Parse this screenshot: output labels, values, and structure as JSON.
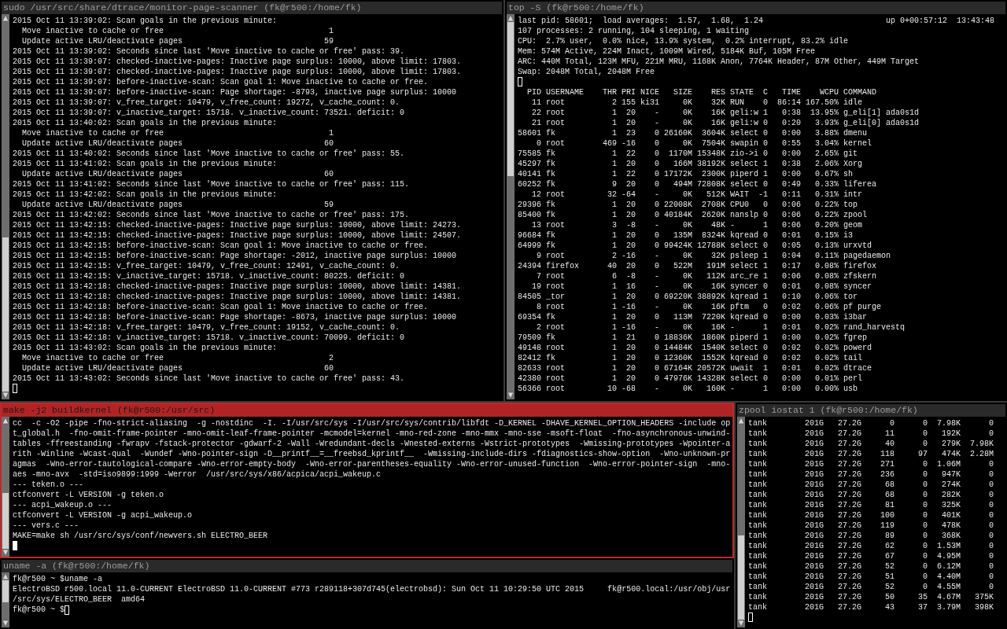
{
  "monitor_pane": {
    "title": "sudo /usr/src/share/dtrace/monitor-page-scanner (fk@r500:/home/fk)",
    "focused": false,
    "cursor": {
      "kind": "hollow"
    },
    "lines": [
      {
        "kind": "text",
        "text": "2015 Oct 11 13:39:02: Scan goals in the previous minute:"
      },
      {
        "kind": "goal",
        "label": "Move inactive to cache or free",
        "value": "1"
      },
      {
        "kind": "goal",
        "label": "Update active LRU/deactivate pages",
        "value": "59"
      },
      {
        "kind": "text",
        "text": "2015 Oct 11 13:39:02: Seconds since last 'Move inactive to cache or free' pass: 39."
      },
      {
        "kind": "text",
        "text": "2015 Oct 11 13:39:07: checked-inactive-pages: Inactive page surplus: 10000, above limit: 17803."
      },
      {
        "kind": "text",
        "text": "2015 Oct 11 13:39:07: checked-inactive-pages: Inactive page surplus: 10000, above limit: 17803."
      },
      {
        "kind": "text",
        "text": "2015 Oct 11 13:39:07: before-inactive-scan: Scan goal 1: Move inactive to cache or free."
      },
      {
        "kind": "text",
        "text": "2015 Oct 11 13:39:07: before-inactive-scan: Page shortage: -8793, inactive page surplus: 10000"
      },
      {
        "kind": "text",
        "text": "2015 Oct 11 13:39:07: v_free_target: 10479, v_free_count: 19272, v_cache_count: 0."
      },
      {
        "kind": "text",
        "text": "2015 Oct 11 13:39:07: v_inactive_target: 15718. v_inactive_count: 73521. deficit: 0"
      },
      {
        "kind": "text",
        "text": "2015 Oct 11 13:40:02: Scan goals in the previous minute:"
      },
      {
        "kind": "goal",
        "label": "Move inactive to cache or free",
        "value": "1"
      },
      {
        "kind": "goal",
        "label": "Update active LRU/deactivate pages",
        "value": "60"
      },
      {
        "kind": "text",
        "text": "2015 Oct 11 13:40:02: Seconds since last 'Move inactive to cache or free' pass: 55."
      },
      {
        "kind": "text",
        "text": "2015 Oct 11 13:41:02: Scan goals in the previous minute:"
      },
      {
        "kind": "goal",
        "label": "Update active LRU/deactivate pages",
        "value": "60"
      },
      {
        "kind": "text",
        "text": "2015 Oct 11 13:41:02: Seconds since last 'Move inactive to cache or free' pass: 115."
      },
      {
        "kind": "text",
        "text": "2015 Oct 11 13:42:02: Scan goals in the previous minute:"
      },
      {
        "kind": "goal",
        "label": "Update active LRU/deactivate pages",
        "value": "59"
      },
      {
        "kind": "text",
        "text": "2015 Oct 11 13:42:02: Seconds since last 'Move inactive to cache or free' pass: 175."
      },
      {
        "kind": "text",
        "text": "2015 Oct 11 13:42:15: checked-inactive-pages: Inactive page surplus: 10000, above limit: 24273."
      },
      {
        "kind": "text",
        "text": "2015 Oct 11 13:42:15: checked-inactive-pages: Inactive page surplus: 10000, above limit: 24507."
      },
      {
        "kind": "text",
        "text": "2015 Oct 11 13:42:15: before-inactive-scan: Scan goal 1: Move inactive to cache or free."
      },
      {
        "kind": "text",
        "text": "2015 Oct 11 13:42:15: before-inactive-scan: Page shortage: -2012, inactive page surplus: 10000"
      },
      {
        "kind": "text",
        "text": "2015 Oct 11 13:42:15: v_free_target: 10479, v_free_count: 12491, v_cache_count: 0."
      },
      {
        "kind": "text",
        "text": "2015 Oct 11 13:42:15: v_inactive_target: 15718. v_inactive_count: 80225. deficit: 0"
      },
      {
        "kind": "text",
        "text": "2015 Oct 11 13:42:18: checked-inactive-pages: Inactive page surplus: 10000, above limit: 14381."
      },
      {
        "kind": "text",
        "text": "2015 Oct 11 13:42:18: checked-inactive-pages: Inactive page surplus: 10000, above limit: 14381."
      },
      {
        "kind": "text",
        "text": "2015 Oct 11 13:42:18: before-inactive-scan: Scan goal 1: Move inactive to cache or free."
      },
      {
        "kind": "text",
        "text": "2015 Oct 11 13:42:18: before-inactive-scan: Page shortage: -8673, inactive page surplus: 10000"
      },
      {
        "kind": "text",
        "text": "2015 Oct 11 13:42:18: v_free_target: 10479, v_free_count: 19152, v_cache_count: 0."
      },
      {
        "kind": "text",
        "text": "2015 Oct 11 13:42:18: v_inactive_target: 15718. v_inactive_count: 70099. deficit: 0"
      },
      {
        "kind": "text",
        "text": "2015 Oct 11 13:43:02: Scan goals in the previous minute:"
      },
      {
        "kind": "goal",
        "label": "Move inactive to cache or free",
        "value": "2"
      },
      {
        "kind": "goal",
        "label": "Update active LRU/deactivate pages",
        "value": "60"
      },
      {
        "kind": "text",
        "text": "2015 Oct 11 13:43:02: Seconds since last 'Move inactive to cache or free' pass: 43."
      }
    ]
  },
  "top_pane": {
    "title": "top -S (fk@r500:/home/fk)",
    "focused": false,
    "cursor": {
      "kind": "hollow"
    },
    "header_left": "last pid: 58601;  load averages:  1.57,  1.68,  1.24",
    "header_right": "up 0+00:57:12  13:43:48",
    "summary": [
      "107 processes: 2 running, 104 sleeping, 1 waiting",
      "CPU:  2.7% user,  0.0% nice, 13.9% system,  0.2% interrupt, 83.2% idle",
      "Mem: 574M Active, 224M Inact, 1009M Wired, 5184K Buf, 105M Free",
      "ARC: 440M Total, 123M MFU, 221M MRU, 1168K Anon, 7764K Header, 87M Other, 449M Target",
      "Swap: 2048M Total, 2048M Free"
    ],
    "columns": [
      "PID",
      "USERNAME",
      "THR",
      "PRI",
      "NICE",
      "SIZE",
      "RES",
      "STATE",
      "C",
      "TIME",
      "WCPU",
      "COMMAND"
    ],
    "rows": [
      [
        "11",
        "root",
        "2",
        "155",
        "ki31",
        "0K",
        "32K",
        "RUN",
        "0",
        "86:14",
        "167.50%",
        "idle"
      ],
      [
        "22",
        "root",
        "1",
        "20",
        "-",
        "0K",
        "16K",
        "geli:w",
        "1",
        "0:38",
        "13.95%",
        "g_eli[1] ada0s1d"
      ],
      [
        "21",
        "root",
        "1",
        "20",
        "-",
        "0K",
        "16K",
        "geli:w",
        "0",
        "0:20",
        "3.93%",
        "g_eli[0] ada0s1d"
      ],
      [
        "58601",
        "fk",
        "1",
        "23",
        "0",
        "26160K",
        "3604K",
        "select",
        "0",
        "0:00",
        "3.88%",
        "dmenu"
      ],
      [
        "0",
        "root",
        "469",
        "-16",
        "0",
        "0K",
        "7504K",
        "swapin",
        "0",
        "0:55",
        "3.04%",
        "kernel"
      ],
      [
        "75585",
        "fk",
        "1",
        "22",
        "0",
        "1170M",
        "15348K",
        "zio->i",
        "0",
        "0:00",
        "2.65%",
        "git"
      ],
      [
        "45297",
        "fk",
        "1",
        "20",
        "0",
        "166M",
        "38192K",
        "select",
        "1",
        "0:38",
        "2.06%",
        "Xorg"
      ],
      [
        "40141",
        "fk",
        "1",
        "22",
        "0",
        "17172K",
        "2300K",
        "piperd",
        "1",
        "0:00",
        "0.67%",
        "sh"
      ],
      [
        "60252",
        "fk",
        "9",
        "20",
        "0",
        "494M",
        "72808K",
        "select",
        "0",
        "0:49",
        "0.33%",
        "liferea"
      ],
      [
        "12",
        "root",
        "32",
        "-64",
        "-",
        "0K",
        "512K",
        "WAIT",
        "-1",
        "0:11",
        "0.31%",
        "intr"
      ],
      [
        "29396",
        "fk",
        "1",
        "20",
        "0",
        "22008K",
        "2708K",
        "CPU0",
        "0",
        "0:06",
        "0.22%",
        "top"
      ],
      [
        "85400",
        "fk",
        "1",
        "20",
        "0",
        "40184K",
        "2620K",
        "nanslp",
        "0",
        "0:06",
        "0.22%",
        "zpool"
      ],
      [
        "13",
        "root",
        "3",
        "-8",
        "-",
        "0K",
        "48K",
        "-",
        "1",
        "0:06",
        "0.20%",
        "geom"
      ],
      [
        "96684",
        "fk",
        "1",
        "20",
        "0",
        "135M",
        "8324K",
        "kqread",
        "0",
        "0:01",
        "0.15%",
        "i3"
      ],
      [
        "64999",
        "fk",
        "1",
        "20",
        "0",
        "99424K",
        "12788K",
        "select",
        "0",
        "0:05",
        "0.13%",
        "urxvtd"
      ],
      [
        "9",
        "root",
        "2",
        "-16",
        "-",
        "0K",
        "32K",
        "psleep",
        "1",
        "0:04",
        "0.11%",
        "pagedaemon"
      ],
      [
        "24394",
        "firefox",
        "40",
        "20",
        "0",
        "522M",
        "191M",
        "select",
        "1",
        "0:17",
        "0.08%",
        "firefox"
      ],
      [
        "7",
        "root",
        "6",
        "-8",
        "-",
        "0K",
        "112K",
        "arc_re",
        "1",
        "0:06",
        "0.08%",
        "zfskern"
      ],
      [
        "19",
        "root",
        "1",
        "16",
        "-",
        "0K",
        "16K",
        "syncer",
        "0",
        "0:01",
        "0.08%",
        "syncer"
      ],
      [
        "84505",
        "_tor",
        "1",
        "20",
        "0",
        "69220K",
        "38892K",
        "kqread",
        "1",
        "0:10",
        "0.06%",
        "tor"
      ],
      [
        "8",
        "root",
        "1",
        "-16",
        "-",
        "0K",
        "16K",
        "pftm",
        "0",
        "0:02",
        "0.06%",
        "pf purge"
      ],
      [
        "69354",
        "fk",
        "1",
        "20",
        "0",
        "113M",
        "7220K",
        "kqread",
        "0",
        "0:00",
        "0.03%",
        "i3bar"
      ],
      [
        "2",
        "root",
        "1",
        "-16",
        "-",
        "0K",
        "16K",
        "-",
        "1",
        "0:01",
        "0.02%",
        "rand_harvestq"
      ],
      [
        "79509",
        "fk",
        "1",
        "21",
        "0",
        "18836K",
        "1860K",
        "piperd",
        "1",
        "0:00",
        "0.02%",
        "fgrep"
      ],
      [
        "49148",
        "root",
        "1",
        "20",
        "0",
        "14484K",
        "1540K",
        "select",
        "0",
        "0:02",
        "0.02%",
        "powerd"
      ],
      [
        "82412",
        "fk",
        "1",
        "20",
        "0",
        "12360K",
        "1552K",
        "kqread",
        "0",
        "0:02",
        "0.02%",
        "tail"
      ],
      [
        "82633",
        "root",
        "1",
        "20",
        "0",
        "67164K",
        "20572K",
        "uwait",
        "1",
        "0:01",
        "0.02%",
        "dtrace"
      ],
      [
        "42380",
        "root",
        "1",
        "20",
        "0",
        "47976K",
        "14328K",
        "select",
        "0",
        "0:00",
        "0.01%",
        "perl"
      ],
      [
        "56366",
        "root",
        "10",
        "-68",
        "-",
        "0K",
        "160K",
        "-",
        "1",
        "0:00",
        "0.00%",
        "usb"
      ]
    ]
  },
  "make_pane": {
    "title": "make -j2 buildkernel (fk@r500:/usr/src)",
    "focused": true,
    "cursor": {
      "kind": "block"
    },
    "lines": [
      "cc  -c -O2 -pipe -fno-strict-aliasing  -g -nostdinc  -I. -I/usr/src/sys -I/usr/src/sys/contrib/libfdt -D_KERNEL -DHAVE_KERNEL_OPTION_HEADERS -include op",
      "t_global.h  -fno-omit-frame-pointer -mno-omit-leaf-frame-pointer -mcmodel=kernel -mno-red-zone -mno-mmx -mno-sse -msoft-float  -fno-asynchronous-unwind-",
      "tables -ffreestanding -fwrapv -fstack-protector -gdwarf-2 -Wall -Wredundant-decls -Wnested-externs -Wstrict-prototypes  -Wmissing-prototypes -Wpointer-a",
      "rith -Winline -Wcast-qual  -Wundef -Wno-pointer-sign -D__printf__=__freebsd_kprintf__  -Wmissing-include-dirs -fdiagnostics-show-option  -Wno-unknown-pr",
      "agmas  -Wno-error-tautological-compare -Wno-error-empty-body  -Wno-error-parentheses-equality -Wno-error-unused-function  -Wno-error-pointer-sign  -mno-",
      "aes -mno-avx  -std=iso9899:1999 -Werror  /usr/src/sys/x86/acpica/acpi_wakeup.c",
      "--- teken.o ---",
      "ctfconvert -L VERSION -g teken.o",
      "--- acpi_wakeup.o ---",
      "ctfconvert -L VERSION -g acpi_wakeup.o",
      "--- vers.c ---",
      "MAKE=make sh /usr/src/sys/conf/newvers.sh ELECTRO_BEER"
    ]
  },
  "uname_pane": {
    "title": "uname -a (fk@r500:/home/fk)",
    "focused": false,
    "cursor": {
      "kind": "hollow"
    },
    "prompt": "fk@r500 ~ $",
    "lines": [
      "fk@r500 ~ $uname -a",
      "ElectroBSD r500.local 11.0-CURRENT ElectroBSD 11.0-CURRENT #773 r289118+307d745(electrobsd): Sun Oct 11 10:29:50 UTC 2015     fk@r500.local:/usr/obj/usr",
      "/src/sys/ELECTRO_BEER  amd64"
    ]
  },
  "iostat_pane": {
    "title": "zpool iostat 1 (fk@r500:/home/fk)",
    "focused": false,
    "cursor": {
      "kind": "hollow"
    },
    "rows": [
      [
        "tank",
        "201G",
        "27.2G",
        "0",
        "0",
        "7.98K",
        "0"
      ],
      [
        "tank",
        "201G",
        "27.2G",
        "11",
        "0",
        "192K",
        "0"
      ],
      [
        "tank",
        "201G",
        "27.2G",
        "40",
        "0",
        "279K",
        "7.98K"
      ],
      [
        "tank",
        "201G",
        "27.2G",
        "118",
        "97",
        "474K",
        "2.28M"
      ],
      [
        "tank",
        "201G",
        "27.2G",
        "271",
        "0",
        "1.06M",
        "0"
      ],
      [
        "tank",
        "201G",
        "27.2G",
        "236",
        "0",
        "947K",
        "0"
      ],
      [
        "tank",
        "201G",
        "27.2G",
        "68",
        "0",
        "274K",
        "0"
      ],
      [
        "tank",
        "201G",
        "27.2G",
        "68",
        "0",
        "282K",
        "0"
      ],
      [
        "tank",
        "201G",
        "27.2G",
        "81",
        "0",
        "325K",
        "0"
      ],
      [
        "tank",
        "201G",
        "27.2G",
        "100",
        "0",
        "401K",
        "0"
      ],
      [
        "tank",
        "201G",
        "27.2G",
        "119",
        "0",
        "478K",
        "0"
      ],
      [
        "tank",
        "201G",
        "27.2G",
        "89",
        "0",
        "368K",
        "0"
      ],
      [
        "tank",
        "201G",
        "27.2G",
        "62",
        "0",
        "1.53M",
        "0"
      ],
      [
        "tank",
        "201G",
        "27.2G",
        "67",
        "0",
        "4.95M",
        "0"
      ],
      [
        "tank",
        "201G",
        "27.2G",
        "52",
        "0",
        "6.12M",
        "0"
      ],
      [
        "tank",
        "201G",
        "27.2G",
        "51",
        "0",
        "4.40M",
        "0"
      ],
      [
        "tank",
        "201G",
        "27.2G",
        "52",
        "0",
        "4.55M",
        "0"
      ],
      [
        "tank",
        "201G",
        "27.2G",
        "50",
        "35",
        "4.67M",
        "375K"
      ],
      [
        "tank",
        "201G",
        "27.2G",
        "43",
        "37",
        "3.79M",
        "398K"
      ]
    ]
  }
}
